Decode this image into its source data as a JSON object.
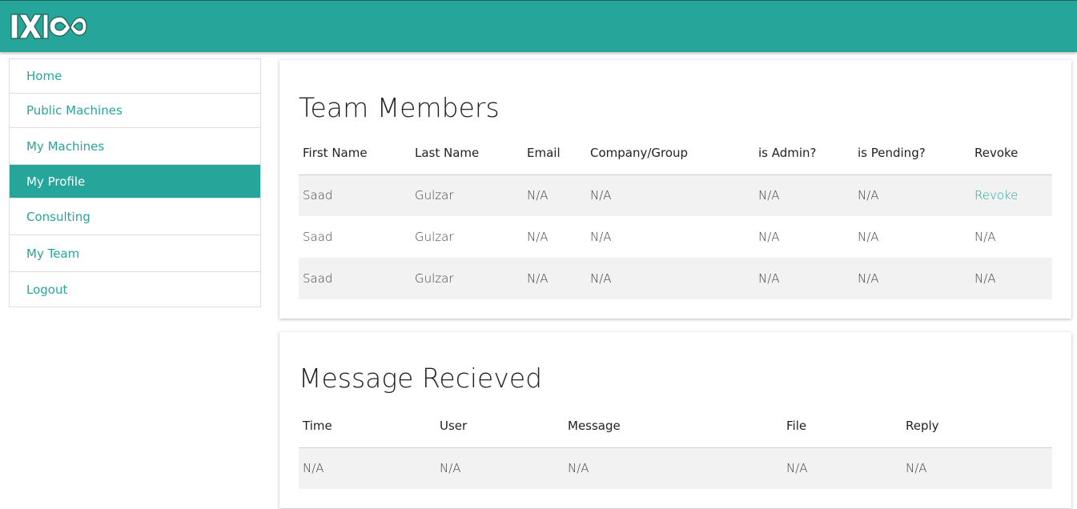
{
  "brand": {
    "logo_text": "IXICO",
    "accent": "#26a69a"
  },
  "sidebar": {
    "items": [
      {
        "label": "Home",
        "active": false
      },
      {
        "label": "Public Machines",
        "active": false
      },
      {
        "label": "My Machines",
        "active": false
      },
      {
        "label": "My Profile",
        "active": true
      },
      {
        "label": "Consulting",
        "active": false
      },
      {
        "label": "My Team",
        "active": false
      },
      {
        "label": "Logout",
        "active": false
      }
    ]
  },
  "team": {
    "title": "Team Members",
    "columns": [
      "First Name",
      "Last Name",
      "Email",
      "Company/Group",
      "is Admin?",
      "is Pending?",
      "Revoke"
    ],
    "rows": [
      [
        "Saad",
        "Gulzar",
        "N/A",
        "N/A",
        "N/A",
        "N/A",
        "Revoke"
      ],
      [
        "Saad",
        "Gulzar",
        "N/A",
        "N/A",
        "N/A",
        "N/A",
        "N/A"
      ],
      [
        "Saad",
        "Gulzar",
        "N/A",
        "N/A",
        "N/A",
        "N/A",
        "N/A"
      ]
    ]
  },
  "messages": {
    "title": "Message Recieved",
    "columns": [
      "Time",
      "User",
      "Message",
      "File",
      "Reply"
    ],
    "rows": [
      [
        "N/A",
        "N/A",
        "N/A",
        "N/A",
        "N/A"
      ]
    ]
  }
}
